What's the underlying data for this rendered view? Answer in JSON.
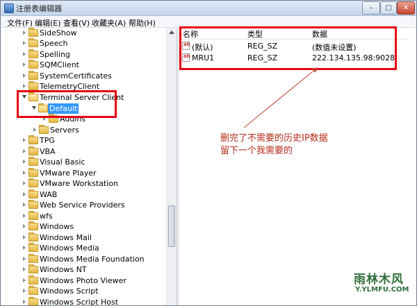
{
  "window": {
    "title": "注册表编辑器",
    "controls": [
      "–",
      "□",
      "✕"
    ]
  },
  "menu": [
    "文件(F)",
    "编辑(E)",
    "查看(V)",
    "收藏夹(A)",
    "帮助(H)"
  ],
  "tree": {
    "items": [
      {
        "label": "SideShow",
        "state": "collapsed"
      },
      {
        "label": "Speech",
        "state": "collapsed"
      },
      {
        "label": "Spelling",
        "state": "collapsed"
      },
      {
        "label": "SQMClient",
        "state": "collapsed"
      },
      {
        "label": "SystemCertificates",
        "state": "collapsed"
      },
      {
        "label": "TelemetryClient",
        "state": "collapsed"
      },
      {
        "label": "Terminal Server Client",
        "state": "expanded"
      },
      {
        "label": "Default",
        "state": "selected"
      },
      {
        "label": "Addins",
        "state": "collapsed"
      },
      {
        "label": "Servers",
        "state": "collapsed"
      },
      {
        "label": "TPG",
        "state": "collapsed"
      },
      {
        "label": "VBA",
        "state": "collapsed"
      },
      {
        "label": "Visual Basic",
        "state": "collapsed"
      },
      {
        "label": "VMware Player",
        "state": "collapsed"
      },
      {
        "label": "VMware Workstation",
        "state": "collapsed"
      },
      {
        "label": "WAB",
        "state": "collapsed"
      },
      {
        "label": "Web Service Providers",
        "state": "collapsed"
      },
      {
        "label": "wfs",
        "state": "collapsed"
      },
      {
        "label": "Windows",
        "state": "collapsed"
      },
      {
        "label": "Windows Mail",
        "state": "collapsed"
      },
      {
        "label": "Windows Media",
        "state": "collapsed"
      },
      {
        "label": "Windows Media Foundation",
        "state": "collapsed"
      },
      {
        "label": "Windows NT",
        "state": "collapsed"
      },
      {
        "label": "Windows Photo Viewer",
        "state": "collapsed"
      },
      {
        "label": "Windows Script",
        "state": "collapsed"
      },
      {
        "label": "Windows Script Host",
        "state": "collapsed"
      }
    ]
  },
  "values": {
    "columns": [
      "名称",
      "类型",
      "数据"
    ],
    "rows": [
      {
        "name": "(默认)",
        "type": "REG_SZ",
        "data": "(数值未设置)",
        "icon": "string-value-icon"
      },
      {
        "name": "MRU1",
        "type": "REG_SZ",
        "data": "222.134.135.98:9028",
        "icon": "string-value-icon"
      }
    ]
  },
  "annotation": {
    "line1": "删完了不需要的历史IP数据",
    "line2": "留下一个我需要的"
  },
  "watermark": {
    "main": "雨林木风",
    "sub": "Y.YLMFU.COM"
  },
  "colors": {
    "highlight": "#e60012",
    "annotation_text": "#b32b1a",
    "selection": "#3399ff"
  }
}
